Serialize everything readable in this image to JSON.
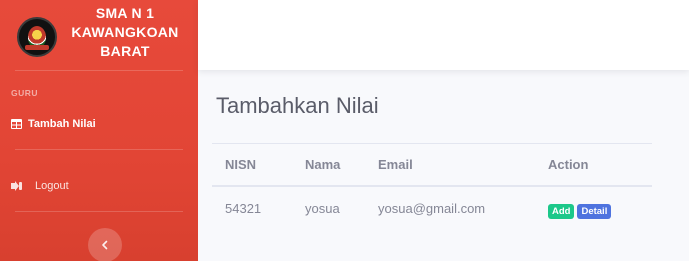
{
  "sidebar": {
    "brand_line1": "SMA N 1",
    "brand_line2": "KAWANGKOAN",
    "brand_line3": "BARAT",
    "heading": "GURU",
    "nav_active_label": "Tambah Nilai",
    "nav_logout_label": "Logout",
    "toggle_icon": "chevron-left-icon",
    "color": "#e74a3b"
  },
  "main": {
    "title": "Tambahkan Nilai",
    "table": {
      "headers": [
        "NISN",
        "Nama",
        "Email",
        "Action"
      ],
      "rows": [
        {
          "nisn": "54321",
          "nama": "yosua",
          "email": "yosua@gmail.com",
          "add_label": "Add",
          "detail_label": "Detail"
        }
      ]
    }
  },
  "colors": {
    "add_badge": "#1cc88a",
    "detail_badge": "#4e73df",
    "text": "#858796"
  }
}
